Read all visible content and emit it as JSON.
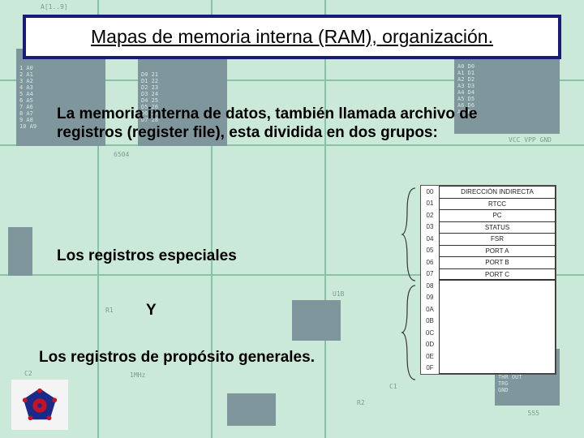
{
  "title": "Mapas de memoria interna (RAM), organización.",
  "paragraph": "La memoria interna de datos, también llamada archivo de registros (register file), esta dividida en dos grupos:",
  "label_special": "Los registros especiales",
  "label_y": "Y",
  "label_general": "Los registros de propósito generales.",
  "mem": {
    "special": [
      {
        "addr": "00",
        "name": "DIRECCIÓN INDIRECTA"
      },
      {
        "addr": "01",
        "name": "RTCC"
      },
      {
        "addr": "02",
        "name": "PC"
      },
      {
        "addr": "03",
        "name": "STATUS"
      },
      {
        "addr": "04",
        "name": "FSR"
      },
      {
        "addr": "05",
        "name": "PORT A"
      },
      {
        "addr": "06",
        "name": "PORT B"
      },
      {
        "addr": "07",
        "name": "PORT C"
      }
    ],
    "general": [
      {
        "addr": "08",
        "name": ""
      },
      {
        "addr": "09",
        "name": ""
      },
      {
        "addr": "0A",
        "name": ""
      },
      {
        "addr": "0B",
        "name": ""
      },
      {
        "addr": "0C",
        "name": ""
      },
      {
        "addr": "0D",
        "name": ""
      },
      {
        "addr": "0E",
        "name": ""
      },
      {
        "addr": "0F",
        "name": ""
      }
    ]
  },
  "bg": {
    "header_label": "A[1..9]",
    "chip_right_pins": "VCC VPP GND",
    "chip_left_part": "6504",
    "chip_e_part": "555",
    "gate_label": "U1B",
    "res_r1": "R1",
    "res_r2": "R2",
    "cap_c1": "C1",
    "cap_c2": "C2",
    "vcc": "VCC",
    "freq": "1MHz"
  }
}
